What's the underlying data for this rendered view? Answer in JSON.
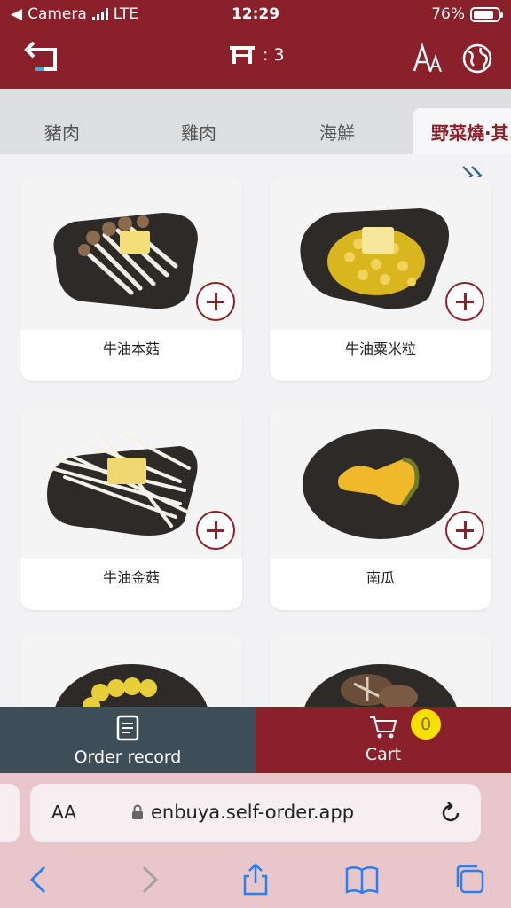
{
  "status": {
    "carrier": "Camera",
    "network": "LTE",
    "time": "12:29",
    "battery": "76%"
  },
  "header": {
    "table_count": ": 3"
  },
  "tabs": [
    {
      "label": "豬肉"
    },
    {
      "label": "雞肉"
    },
    {
      "label": "海鮮"
    },
    {
      "label": "野菜燒·其"
    }
  ],
  "items": [
    {
      "name": "牛油本菇"
    },
    {
      "name": "牛油粟米粒"
    },
    {
      "name": "牛油金菇"
    },
    {
      "name": "南瓜"
    }
  ],
  "bottom_bar": {
    "record_label": "Order record",
    "cart_label": "Cart",
    "cart_count": "0"
  },
  "browser": {
    "aa_label": "AA",
    "url": "enbuya.self-order.app"
  },
  "colors": {
    "brand": "#8a2029",
    "record_bg": "#3e4e59",
    "badge": "#f5e000",
    "ios_blue": "#2a7ff0"
  }
}
